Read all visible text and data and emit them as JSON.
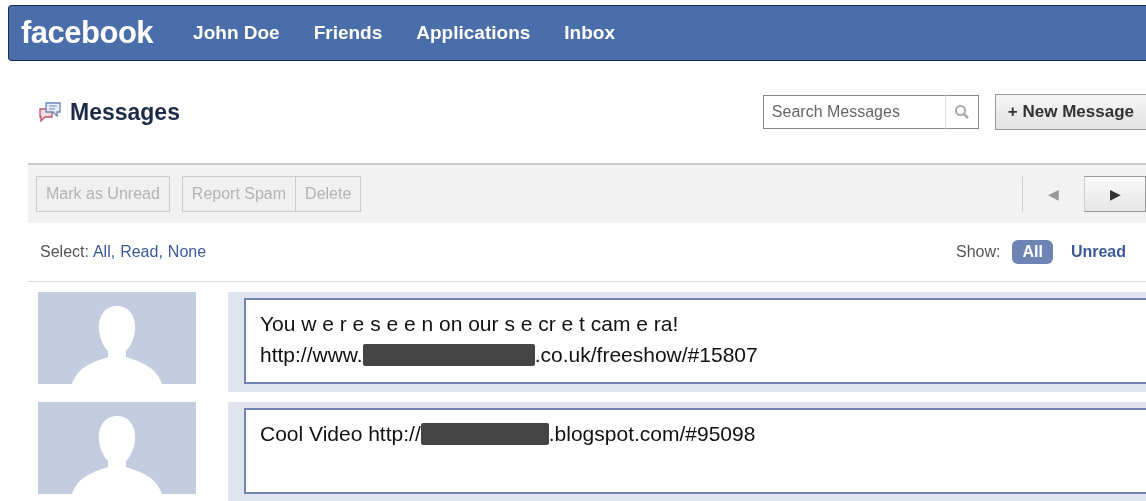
{
  "top_bar": {
    "logo": "facebook",
    "links": [
      "John Doe",
      "Friends",
      "Applications",
      "Inbox"
    ]
  },
  "header": {
    "title": "Messages",
    "search": {
      "placeholder": "Search Messages"
    },
    "new_button": "+ New Message"
  },
  "toolbar": {
    "action_groups": [
      [
        {
          "label": "Mark as Unread",
          "disabled": true
        }
      ],
      [
        {
          "label": "Report Spam",
          "disabled": true
        },
        {
          "label": "Delete",
          "disabled": true
        }
      ]
    ],
    "prev": {
      "symbol": "◀",
      "disabled": true
    },
    "next": {
      "symbol": "▶",
      "disabled": false
    }
  },
  "select": {
    "label": "Select:",
    "options": [
      {
        "label": "All",
        "separator": ","
      },
      {
        "label": "Read",
        "separator": ","
      },
      {
        "label": "None"
      }
    ]
  },
  "show": {
    "label": "Show:",
    "filters": [
      {
        "label": "All",
        "selected": true
      },
      {
        "label": "Unread",
        "selected": false
      }
    ]
  },
  "messages": [
    {
      "lines": [
        [
          {
            "kind": "text",
            "text": "You w e r e s e e n on our s e cr e t cam e ra!"
          }
        ],
        [
          {
            "kind": "text",
            "text": "http://www."
          },
          {
            "kind": "redacted"
          },
          {
            "kind": "text",
            "text": ".co.uk/freeshow/#15807"
          }
        ]
      ]
    },
    {
      "lines": [
        [
          {
            "kind": "text",
            "text": "Cool Video http://"
          },
          {
            "kind": "redacted"
          },
          {
            "kind": "text",
            "text": ".blogspot.com/#95098"
          }
        ]
      ]
    }
  ]
}
